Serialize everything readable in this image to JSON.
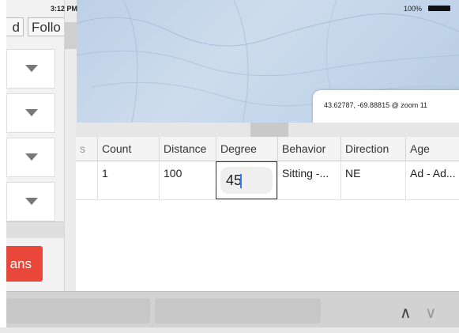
{
  "status_bar": {
    "time": "3:12 PM",
    "battery": "100%"
  },
  "map": {
    "coordinates": "43.62787, -69.88815 @ zoom 11"
  },
  "left_panel": {
    "top_buttons": [
      "d",
      "Follo"
    ],
    "dropdown_count": 4,
    "action_button": "ans"
  },
  "table": {
    "partial_header": "s",
    "columns": [
      "Count",
      "Distance",
      "Degree",
      "Behavior",
      "Direction",
      "Age"
    ],
    "rows": [
      {
        "count": "1",
        "distance": "100",
        "degree": "45",
        "behavior": "Sitting -...",
        "direction": "NE",
        "age": "Ad - Ad..."
      }
    ]
  },
  "bottom_bar": {
    "up_arrow": "∧",
    "down_arrow": "∨"
  },
  "colors": {
    "action_button": "#e8473a",
    "caret": "#3478f6",
    "map_water": "#c2d5ea"
  }
}
